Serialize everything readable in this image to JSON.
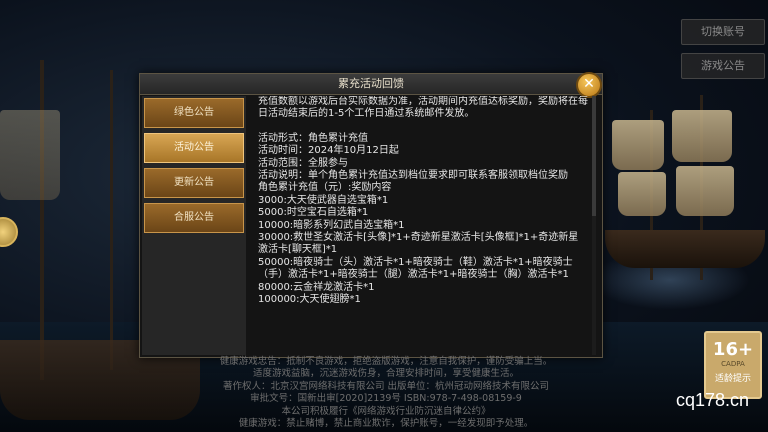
{
  "side_buttons": {
    "switch_account": "切换账号",
    "game_notice": "游戏公告"
  },
  "dialog": {
    "title": "累充活动回馈",
    "close_icon": "close-icon"
  },
  "tabs": [
    {
      "label": "绿色公告",
      "active": false
    },
    {
      "label": "活动公告",
      "active": true
    },
    {
      "label": "更新公告",
      "active": false
    },
    {
      "label": "合服公告",
      "active": false
    }
  ],
  "content": {
    "intro": "充值数额以游戏后台实际数据为准，活动期间内充值达标奖励，奖励将在每日活动结束后的1-5个工作日通过系统邮件发放。",
    "form": "活动形式：角色累计充值",
    "time": "活动时间：2024年10月12日起",
    "scope": "活动范围：全服参与",
    "desc": "活动说明：单个角色累计充值达到档位要求即可联系客服领取档位奖励",
    "header": "角色累计充值（元）:奖励内容",
    "rewards": [
      "3000:大天使武器自选宝箱*1",
      "5000:时空宝石自选箱*1",
      "10000:暗影系列幻武自选宝箱*1",
      "30000:救世圣女激活卡[头像]*1+奇迹新星激活卡[头像框]*1+奇迹新星激活卡[聊天框]*1",
      "50000:暗夜骑士（头）激活卡*1+暗夜骑士（鞋）激活卡*1+暗夜骑士（手）激活卡*1+暗夜骑士（腿）激活卡*1+暗夜骑士（胸）激活卡*1",
      "80000:云金祥龙激活卡*1",
      "100000:大天使翅膀*1"
    ]
  },
  "notice_lines": [
    "健康游戏忠告：抵制不良游戏，拒绝盗版游戏，注意自我保护，谨防受骗上当。",
    "适度游戏益脑，沉迷游戏伤身，合理安排时间，享受健康生活。",
    "著作权人：北京汉宫网络科技有限公司   出版单位：杭州冠动网络技术有限公司",
    "审批文号：国新出审[2020]2139号   ISBN:978-7-498-08159-9",
    "本公司积极履行《网络游戏行业防沉迷自律公约》",
    "健康游戏：禁止赌博，禁止商业欺诈，保护账号，一经发现即予处理。"
  ],
  "age_badge": {
    "rating": "16+",
    "org": "CADPA",
    "tip": "适龄提示"
  },
  "watermark": "cq178.cn"
}
